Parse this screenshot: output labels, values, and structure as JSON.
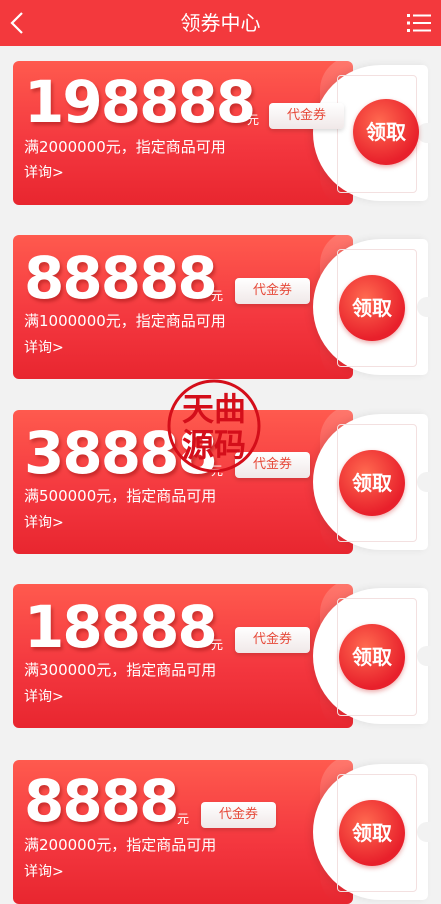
{
  "header": {
    "title": "领券中心",
    "back_icon": "chevron-left-icon",
    "menu_icon": "list-menu-icon"
  },
  "coupons": [
    {
      "amount": "198888",
      "unit": "元",
      "type": "代金券",
      "condition": "满2000000元，指定商品可用",
      "detail": "详询>",
      "claim": "领取"
    },
    {
      "amount": "88888",
      "unit": "元",
      "type": "代金券",
      "condition": "满1000000元，指定商品可用",
      "detail": "详询>",
      "claim": "领取"
    },
    {
      "amount": "38888",
      "unit": "元",
      "type": "代金券",
      "condition": "满500000元，指定商品可用",
      "detail": "详询>",
      "claim": "领取"
    },
    {
      "amount": "18888",
      "unit": "元",
      "type": "代金券",
      "condition": "满300000元，指定商品可用",
      "detail": "详询>",
      "claim": "领取"
    },
    {
      "amount": "8888",
      "unit": "元",
      "type": "代金券",
      "condition": "满200000元，指定商品可用",
      "detail": "详询>",
      "claim": "领取"
    }
  ],
  "watermark": {
    "line1": "天曲",
    "line2": "源码"
  },
  "colors": {
    "header": "#f3393d",
    "coupon": "#f3363e",
    "background": "#f2f2f2"
  }
}
